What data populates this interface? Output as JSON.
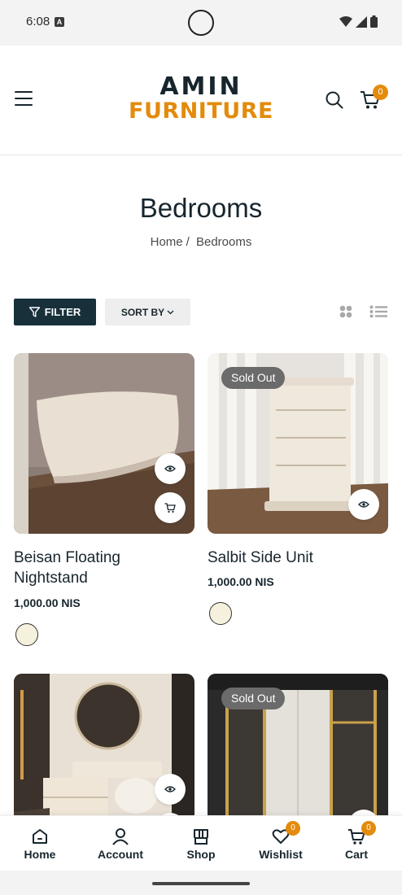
{
  "status_bar": {
    "time": "6:08",
    "notification_letter": "A"
  },
  "header": {
    "logo_top": "AMIN",
    "logo_bottom": "FURNITURE",
    "cart_count": "0"
  },
  "page": {
    "title": "Bedrooms",
    "breadcrumb_home": "Home",
    "breadcrumb_sep": "/",
    "breadcrumb_current": "Bedrooms"
  },
  "toolbar": {
    "filter_label": "FILTER",
    "sort_label": "SORT BY"
  },
  "products": [
    {
      "name": "Beisan Floating Nightstand",
      "price": "1,000.00 NIS",
      "sold_out": false,
      "swatch_color": "#f5f1dd"
    },
    {
      "name": "Salbit Side Unit",
      "price": "1,000.00 NIS",
      "sold_out": true,
      "badge": "Sold Out",
      "swatch_color": "#f5f1dd"
    },
    {
      "sold_out": false
    },
    {
      "sold_out": true,
      "badge": "Sold Out"
    }
  ],
  "bottom_nav": {
    "home": "Home",
    "account": "Account",
    "shop": "Shop",
    "wishlist": "Wishlist",
    "wishlist_count": "0",
    "cart": "Cart",
    "cart_count": "0"
  },
  "colors": {
    "accent": "#e38b0c",
    "primary": "#17303a",
    "text": "#17252d"
  }
}
